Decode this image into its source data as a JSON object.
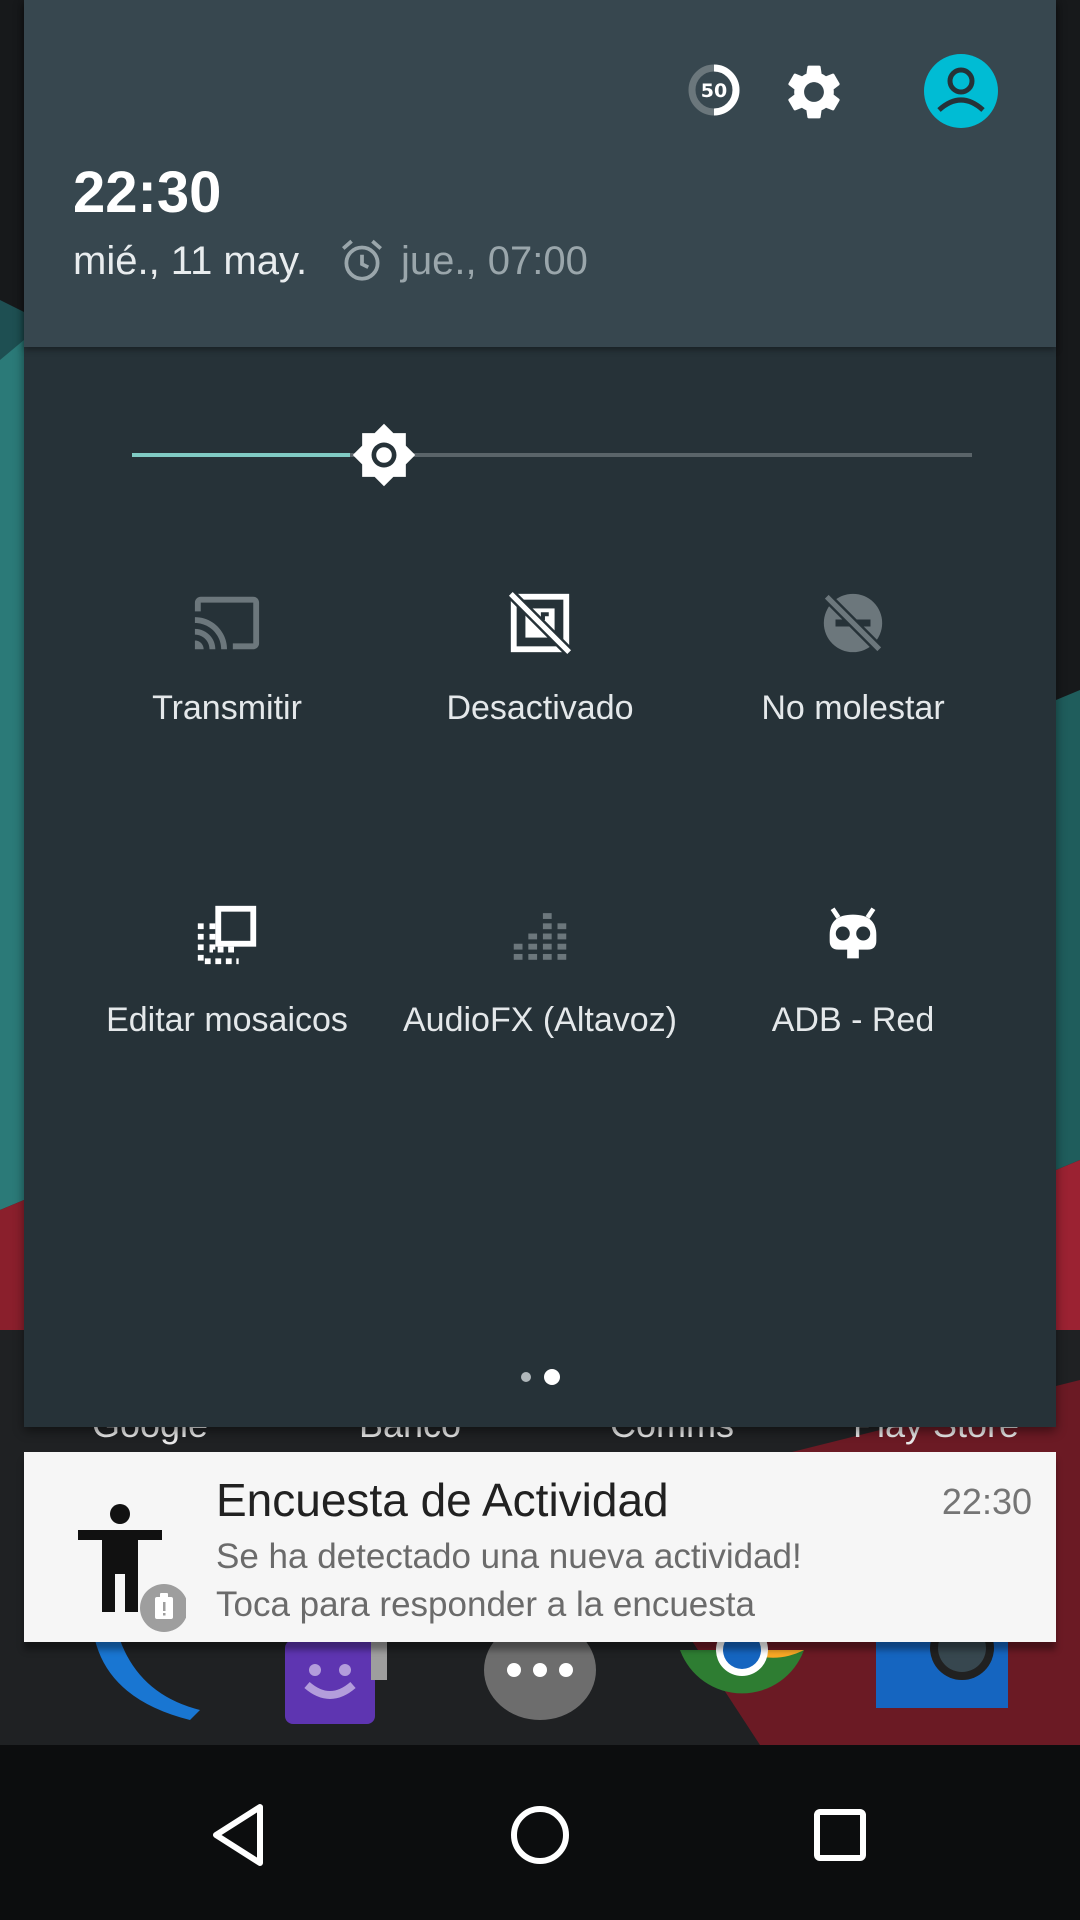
{
  "status": {
    "time": "22:30",
    "date": "mié., 11 may.",
    "alarm": "jue., 07:00",
    "battery_level": "50"
  },
  "brightness": {
    "level": 0.26,
    "accent_color": "#80cbc4"
  },
  "tiles": [
    {
      "label": "Transmitir",
      "icon": "cast-icon",
      "active": false
    },
    {
      "label": "Desactivado",
      "icon": "screen-rotation-off-icon",
      "active": true
    },
    {
      "label": "No molestar",
      "icon": "do-not-disturb-off-icon",
      "active": false
    },
    {
      "label": "Editar mosaicos",
      "icon": "edit-tiles-icon",
      "active": true
    },
    {
      "label": "AudioFX (Altavoz)",
      "icon": "equalizer-icon",
      "active": false
    },
    {
      "label": "ADB - Red",
      "icon": "cyanogen-bugdroid-icon",
      "active": true
    }
  ],
  "pager": {
    "pages": 2,
    "current": 2
  },
  "home_dock_labels": [
    "Google",
    "Banco",
    "Comms",
    "Play Store"
  ],
  "notification": {
    "title": "Encuesta de Actividad",
    "time": "22:30",
    "line1": "Se ha detectado una nueva actividad!",
    "line2": "Toca para responder a la encuesta",
    "icon": "accessibility-person-icon",
    "badge_icon": "clipboard-alert-icon"
  },
  "navigation": {
    "back": "back-icon",
    "home": "home-icon",
    "recents": "recents-icon"
  },
  "colors": {
    "shade_bg": "#263238",
    "header_bg": "#37474f",
    "avatar": "#00bcd4",
    "notification_bg": "#f6f6f6"
  }
}
